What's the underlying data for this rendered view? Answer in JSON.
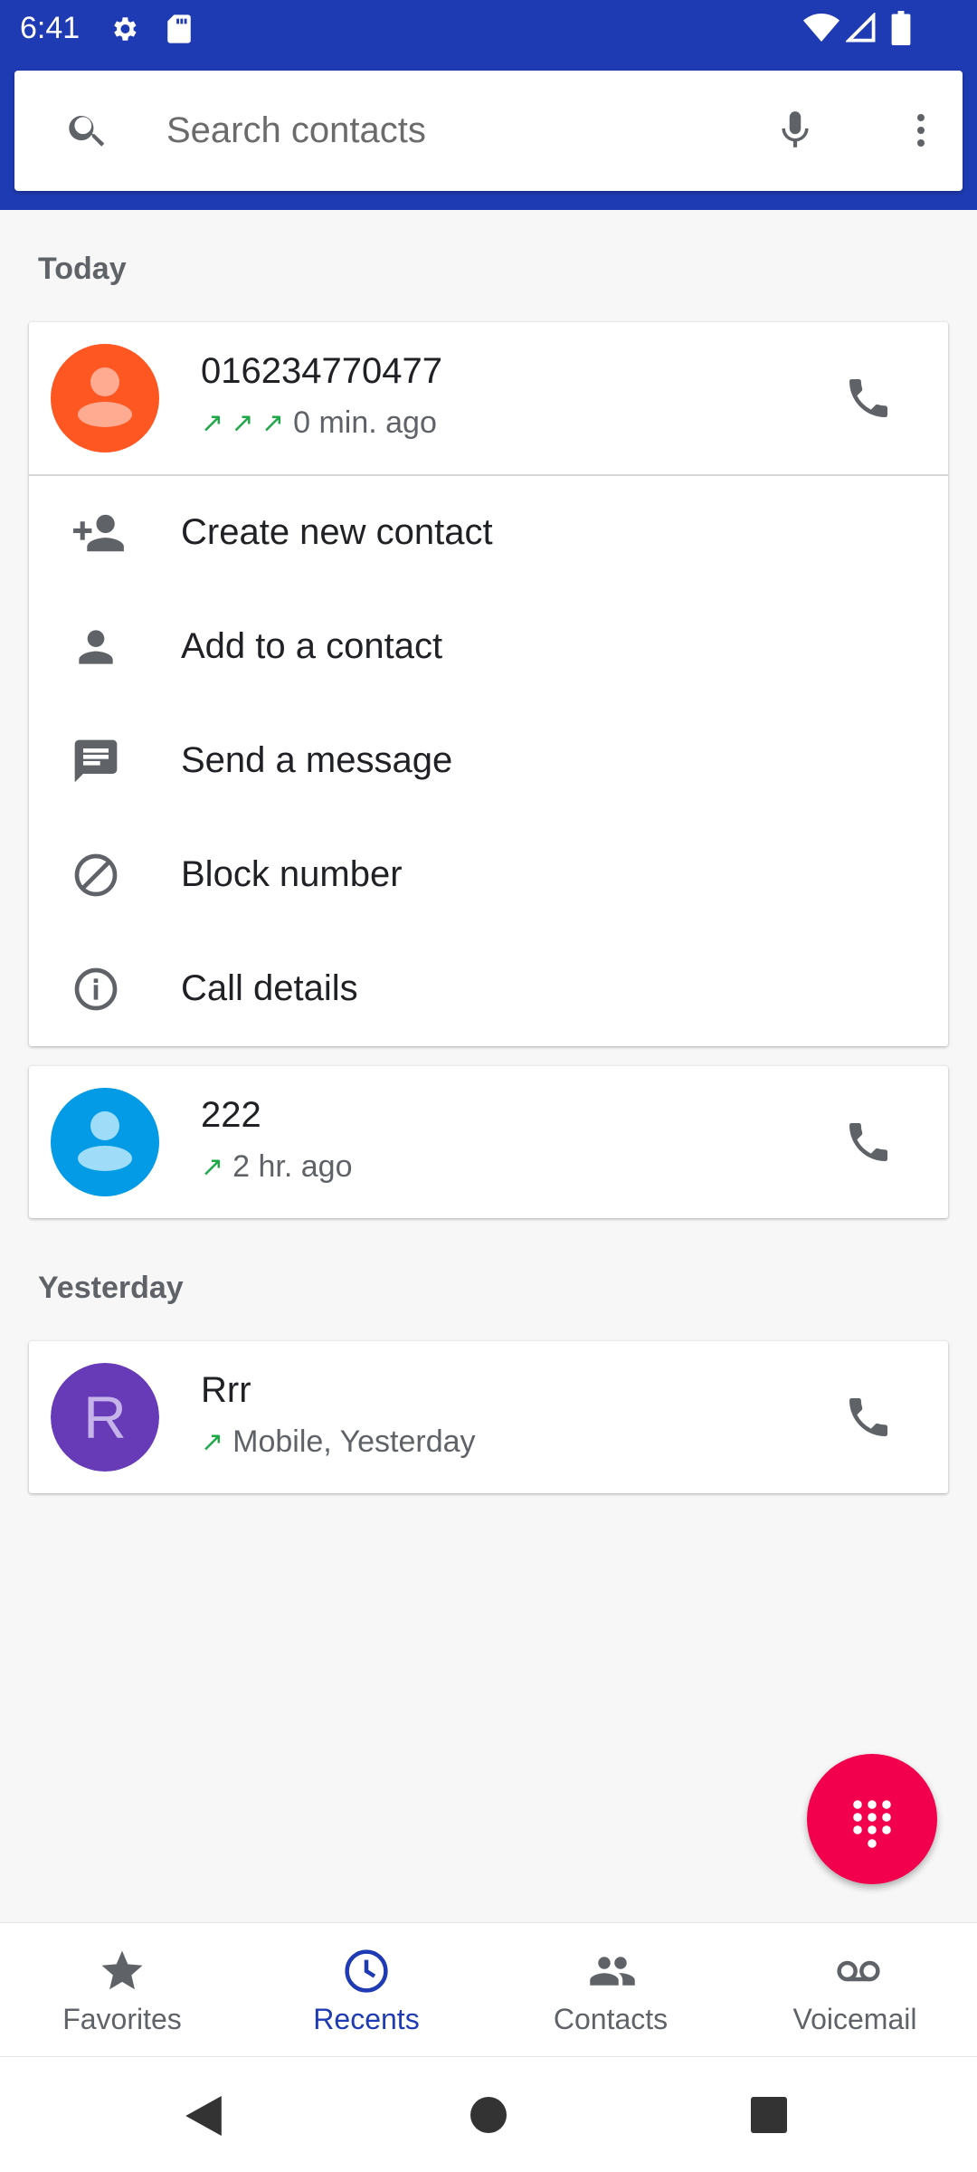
{
  "status_bar": {
    "time": "6:41"
  },
  "search": {
    "placeholder": "Search contacts"
  },
  "sections": {
    "today": "Today",
    "yesterday": "Yesterday"
  },
  "calls": [
    {
      "number": "016234770477",
      "arrows": "↗ ↗ ↗",
      "detail": "0 min. ago",
      "avatar_color": "#ff5722",
      "avatar_fg": "#ffab91"
    },
    {
      "number": "222",
      "arrows": "↗",
      "detail": "2 hr. ago",
      "avatar_color": "#039be5",
      "avatar_fg": "#9fdcf7"
    },
    {
      "number": "Rrr",
      "arrows": "↗",
      "detail": "Mobile, Yesterday",
      "avatar_letter": "R",
      "avatar_color": "#673ab7"
    }
  ],
  "menu": {
    "create_contact": "Create new contact",
    "add_to_contact": "Add to a contact",
    "send_message": "Send a message",
    "block_number": "Block number",
    "call_details": "Call details"
  },
  "nav": {
    "favorites": "Favorites",
    "recents": "Recents",
    "contacts": "Contacts",
    "voicemail": "Voicemail"
  },
  "colors": {
    "primary": "#1f3bb3",
    "fab": "#f2004d",
    "outgoing_arrow": "#1fa848"
  }
}
